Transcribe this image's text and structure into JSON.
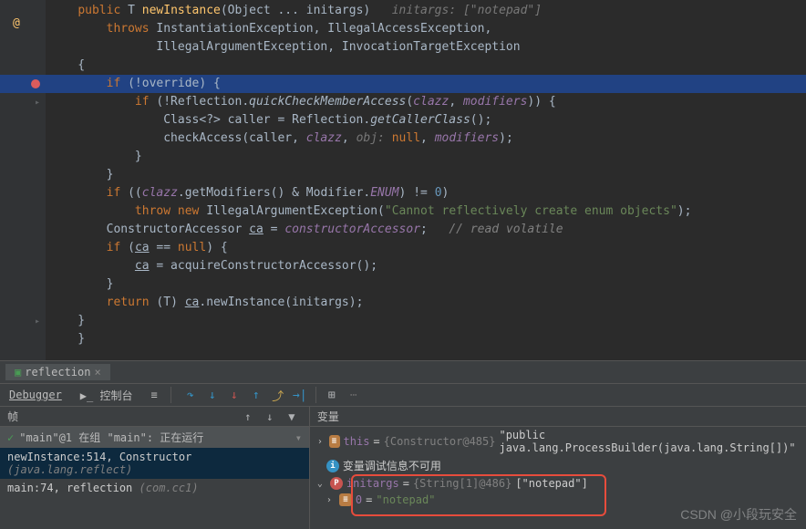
{
  "code": {
    "l1_public": "public",
    "l1_T": "T",
    "l1_method": "newInstance",
    "l1_params": "(Object ... initargs)",
    "l1_hint": "initargs: [\"notepad\"]",
    "l2_throws": "throws",
    "l2_ex1": "InstantiationException",
    "l2_ex2": "IllegalAccessException",
    "l3_ex1": "IllegalArgumentException",
    "l3_ex2": "InvocationTargetException",
    "l5_if": "if",
    "l5_cond": "(!override) {",
    "l6_if": "if",
    "l6_pre": "(!Reflection.",
    "l6_m1": "quickCheckMemberAccess",
    "l6_mid": "(",
    "l6_p1": "clazz",
    "l6_c": ", ",
    "l6_p2": "modifiers",
    "l6_end": ")) {",
    "l7_a": "Class<?> caller = Reflection.",
    "l7_m": "getCallerClass",
    "l7_end": "();",
    "l8_a": "checkAccess(caller, ",
    "l8_p1": "clazz",
    "l8_hint": "obj:",
    "l8_null": "null",
    "l8_p2": "modifiers",
    "l8_end": ");",
    "l11_if": "if",
    "l11_a": " ((",
    "l11_p": "clazz",
    "l11_b": ".getModifiers() & Modifier.",
    "l11_enum": "ENUM",
    "l11_c": ") != ",
    "l11_zero": "0",
    "l11_d": ")",
    "l12_throw": "throw new",
    "l12_ex": "IllegalArgumentException",
    "l12_str": "\"Cannot reflectively create enum objects\"",
    "l13_a": "ConstructorAccessor ",
    "l13_v": "ca",
    "l13_b": " = ",
    "l13_p": "constructorAccessor",
    "l13_c": ";   ",
    "l13_comment": "// read volatile",
    "l14_if": "if",
    "l14_a": " (",
    "l14_v": "ca",
    "l14_b": " == ",
    "l14_null": "null",
    "l14_c": ") {",
    "l15_v": "ca",
    "l15_a": " = acquireConstructorAccessor();",
    "l17_return": "return",
    "l17_a": " (",
    "l17_T": "T",
    "l17_b": ") ",
    "l17_v": "ca",
    "l17_c": ".newInstance(initargs);"
  },
  "debug": {
    "tab_name": "reflection",
    "debugger_label": "Debugger",
    "console_label": "控制台",
    "frames_title": "帧",
    "vars_title": "变量",
    "thread_label": "\"main\"@1 在组 \"main\": 正在运行",
    "frame1_a": "newInstance:514, Constructor",
    "frame1_b": "(java.lang.reflect)",
    "frame2_a": "main:74, reflection",
    "frame2_b": "(com.cc1)",
    "var_this_name": "this",
    "var_this_type": "{Constructor@485}",
    "var_this_val": "\"public java.lang.ProcessBuilder(java.lang.String[])\"",
    "var_unavail": "变量调试信息不可用",
    "var_initargs_name": "initargs",
    "var_initargs_type": "{String[1]@486}",
    "var_initargs_val": "[\"notepad\"]",
    "var_idx0": "0",
    "var_idx0_val": "\"notepad\""
  },
  "watermark": "CSDN @小段玩安全"
}
